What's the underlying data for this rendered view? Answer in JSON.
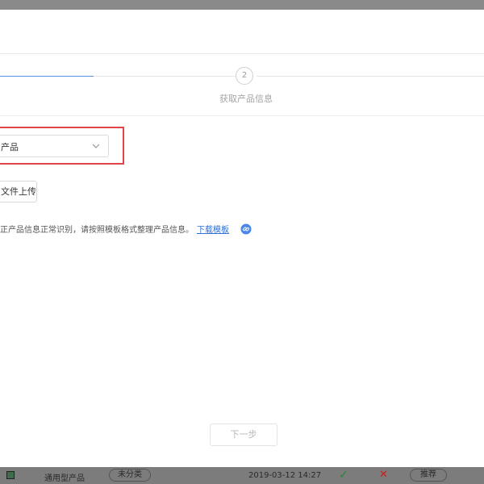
{
  "steps": {
    "current_number": "2",
    "current_label": "获取产品信息"
  },
  "form": {
    "product_type_value": "产品",
    "upload_button_label": "文件上传",
    "tip_text": "正产品信息正常识别，请按照模板格式整理产品信息。",
    "download_template_link": "下载模板"
  },
  "footer": {
    "next_button_label": "下一步"
  },
  "background_row": {
    "product_name": "通用型产品",
    "category_badge": "未分类",
    "date": "2019-03-12 14:27",
    "check_glyph": "✓",
    "cross_glyph": "✕",
    "recommend_label": "推荐"
  },
  "colors": {
    "accent_blue": "#5b8ff0",
    "highlight_red": "#e0454a",
    "link_blue": "#2f6fd6"
  }
}
